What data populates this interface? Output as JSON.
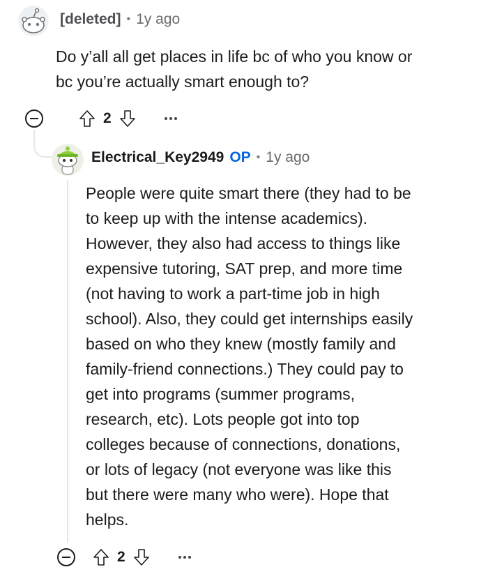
{
  "parent_comment": {
    "author": "[deleted]",
    "separator": "•",
    "time": "1y ago",
    "lines": [
      "Do y’all all get places in life bc of who you know or",
      "bc you’re actually smart enough to?"
    ],
    "score": "2",
    "avatar_icon": "deleted-user-avatar"
  },
  "reply_comment": {
    "author": "Electrical_Key2949",
    "badge": "OP",
    "separator": "•",
    "time": "1y ago",
    "lines": [
      "People were quite smart there (they had to be",
      "to keep up with the intense academics).",
      "However, they also had access to things like",
      "expensive tutoring, SAT prep, and more time",
      "(not having to work a part-time job in high",
      "school). Also, they could get internships easily",
      "based on who they knew (mostly family and",
      "family-friend connections.) They could pay to",
      "get into programs (summer programs,",
      "research, etc). Lots people got into top",
      "colleges because of connections, donations,",
      "or lots of legacy (not everyone was like this",
      "but there were many who were). Hope that",
      "helps."
    ],
    "score": "2",
    "avatar_icon": "snoo-avatar-green-hat"
  },
  "colors": {
    "op_badge": "#0a66d8",
    "thread_line": "#e4e6e8",
    "text": "#1c1c1c",
    "muted": "#6a6a6a"
  }
}
